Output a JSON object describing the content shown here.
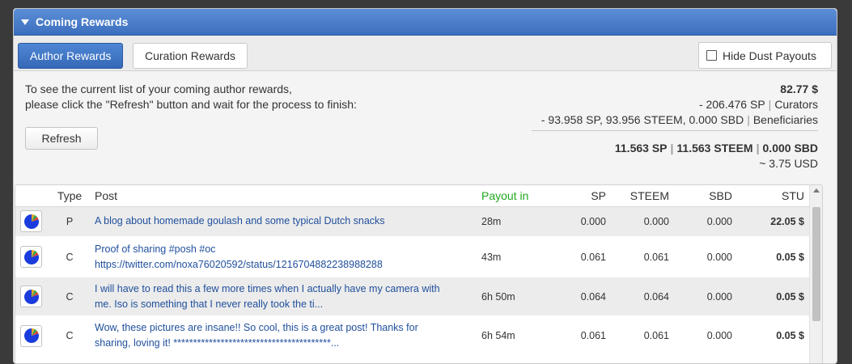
{
  "panel": {
    "title": "Coming Rewards"
  },
  "tabs": {
    "author": "Author Rewards",
    "curation": "Curation Rewards"
  },
  "hide_dust": {
    "label": "Hide Dust Payouts",
    "checked": false
  },
  "intro": {
    "line1": "To see the current list of your coming author rewards,",
    "line2": "please click the \"Refresh\" button and wait for the process to finish:"
  },
  "refresh_button": "Refresh",
  "summary": {
    "total": "82.77 $",
    "curators_amount": "- 206.476 SP",
    "curators_label": "Curators",
    "beneficiaries_amount": "- 93.958 SP, 93.956 STEEM, 0.000 SBD",
    "beneficiaries_label": "Beneficiaries",
    "sp": "11.563 SP",
    "steem": "11.563 STEEM",
    "sbd": "0.000 SBD",
    "usd": "~ 3.75 USD"
  },
  "table": {
    "headers": {
      "type": "Type",
      "post": "Post",
      "payout": "Payout in",
      "sp": "SP",
      "steem": "STEEM",
      "sbd": "SBD",
      "stu": "STU"
    },
    "rows": [
      {
        "type": "P",
        "post_line1": "A blog about homemade goulash and some typical Dutch snacks",
        "post_line2": "",
        "payout": "28m",
        "sp": "0.000",
        "steem": "0.000",
        "sbd": "0.000",
        "stu": "22.05 $",
        "share": 0.8
      },
      {
        "type": "C",
        "post_line1": "Proof of sharing #posh #oc",
        "post_line2": "https://twitter.com/noxa76020592/status/1216704882238988288",
        "payout": "43m",
        "sp": "0.061",
        "steem": "0.061",
        "sbd": "0.000",
        "stu": "0.05 $",
        "share": 0.8
      },
      {
        "type": "C",
        "post_line1": "I will have to read this a few more times when I actually have my camera with",
        "post_line2": "me. Iso is something that I never really took the ti...",
        "payout": "6h 50m",
        "sp": "0.064",
        "steem": "0.064",
        "sbd": "0.000",
        "stu": "0.05 $",
        "share": 0.8
      },
      {
        "type": "C",
        "post_line1": "Wow, these pictures are insane!! So cool, this is a great post! Thanks for",
        "post_line2": "sharing, loving it! ****************************************...",
        "payout": "6h 54m",
        "sp": "0.061",
        "steem": "0.061",
        "sbd": "0.000",
        "stu": "0.05 $",
        "share": 0.8
      }
    ]
  },
  "colors": {
    "pie_main": "#1a3cdc",
    "pie_a": "#e9a12a",
    "pie_b": "#2ea84a",
    "pie_c": "#d64534"
  }
}
